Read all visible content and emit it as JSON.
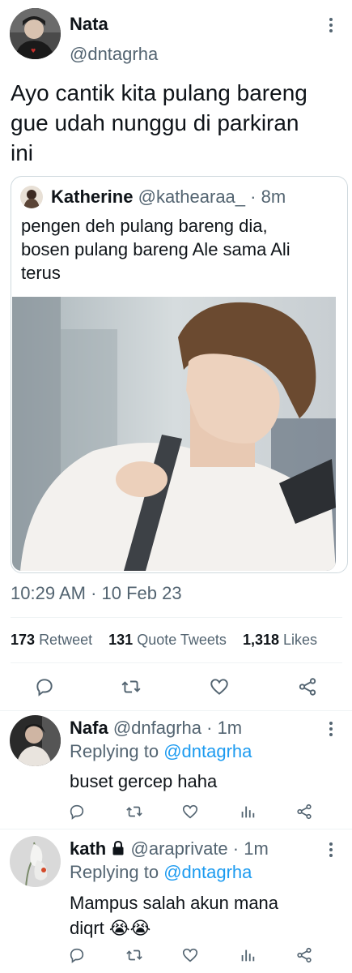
{
  "main_tweet": {
    "author_name": "Nata",
    "author_handle": "@dntagrha",
    "text_lines": [
      "Ayo cantik kita pulang bareng",
      "gue udah nunggu di parkiran",
      "ini"
    ],
    "timestamp": "10:29 AM · 10 Feb 23"
  },
  "quoted_tweet": {
    "author_name": "Katherine",
    "author_handle": "@kathearaa_",
    "time": "· 8m",
    "text_lines": [
      "pengen deh pulang bareng dia,",
      "bosen pulang bareng Ale sama Ali",
      "terus"
    ]
  },
  "stats": {
    "retweets_count": "173",
    "retweets_label": "Retweet",
    "quotes_count": "131",
    "quotes_label": "Quote Tweets",
    "likes_count": "1,318",
    "likes_label": "Likes"
  },
  "replies": [
    {
      "author_name": "Nafa",
      "author_handle": "@dnfagrha",
      "time": "· 1m",
      "replying_prefix": "Replying to",
      "replying_handle": "@dntagrha",
      "text_lines": [
        "buset gercep haha"
      ]
    },
    {
      "author_name": "kath",
      "author_handle": "@araprivate",
      "time": "· 1m",
      "replying_prefix": "Replying to",
      "replying_handle": "@dntagrha",
      "text_lines": [
        "Mampus salah akun mana",
        "diqrt"
      ],
      "emoji": "😭😭"
    }
  ],
  "colors": {
    "text_primary": "#0f1419",
    "text_secondary": "#536471",
    "link_blue": "#1d9bf0",
    "divider": "#eff3f4"
  }
}
